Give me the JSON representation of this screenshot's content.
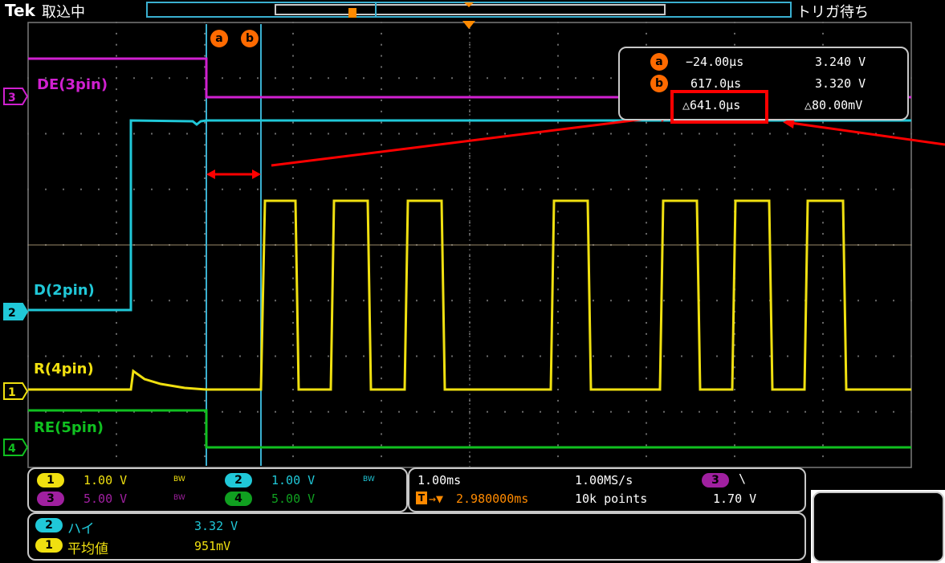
{
  "header": {
    "brand": "Tek",
    "status": "取込中",
    "trigger_state": "トリガ待ち"
  },
  "cursors": {
    "a_label": "a",
    "b_label": "b"
  },
  "channel_labels": {
    "ch3": "DE(3pin)",
    "ch2": "D(2pin)",
    "ch1": "R(4pin)",
    "ch4": "RE(5pin)"
  },
  "channel_markers": {
    "ch1": "1",
    "ch2": "2",
    "ch3": "3",
    "ch4": "4"
  },
  "readout": {
    "a_time": "−24.00μs",
    "a_volt": "3.240 V",
    "b_time": "617.0μs",
    "b_volt": "3.320 V",
    "delta_time": "△641.0μs",
    "delta_volt": "△80.00mV"
  },
  "vertical": {
    "ch1_num": "1",
    "ch1_scale": "1.00 V",
    "ch2_num": "2",
    "ch2_scale": "1.00 V",
    "ch3_num": "3",
    "ch3_scale": "5.00 V",
    "ch4_num": "4",
    "ch4_scale": "5.00 V",
    "bw_label": "BW"
  },
  "horizontal": {
    "time_div": "1.00ms",
    "sample_rate": "1.00MS/s",
    "trigger_pos": "2.980000ms",
    "record_length": "10k points",
    "trig_channel": "3",
    "trig_slope": "\\",
    "trig_level": "1.70 V"
  },
  "measurements": [
    {
      "channel": "2",
      "name": "ハイ",
      "value": "3.32 V"
    },
    {
      "channel": "1",
      "name": "平均値",
      "value": "951mV"
    }
  ],
  "colors": {
    "ch1": "#f0e010",
    "ch2": "#20c8d8",
    "ch3": "#d020d0",
    "ch4": "#10c020",
    "cursor": "#ff6a00",
    "annotation": "#ff0000",
    "grid": "#7a7a7a"
  }
}
